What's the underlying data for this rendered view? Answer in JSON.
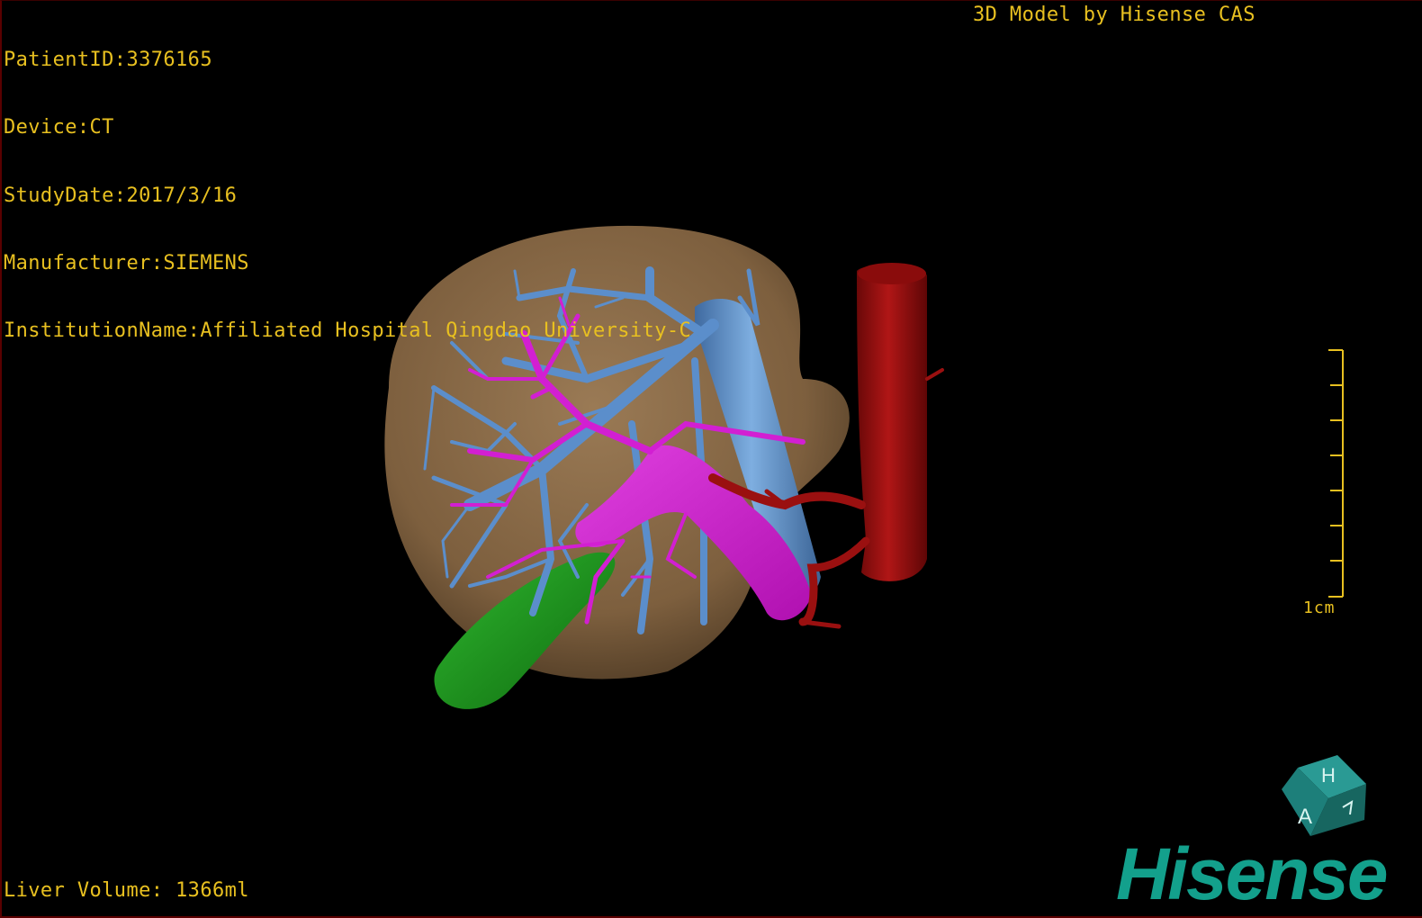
{
  "study": {
    "patient_id": "PatientID:3376165",
    "device": "Device:CT",
    "study_date": "StudyDate:2017/3/16",
    "manufacturer": "Manufacturer:SIEMENS",
    "institution": "InstitutionName:Affiliated Hospital Qingdao University-C"
  },
  "header": {
    "model_credit": "3D Model by Hisense CAS"
  },
  "footer": {
    "liver_volume": "Liver Volume: 1366ml"
  },
  "scale_bar": {
    "label": "1cm",
    "ticks": 8
  },
  "orientation_cube": {
    "face_letters": [
      "H",
      "A"
    ],
    "color": "#1d7f7a"
  },
  "brand": {
    "name": "Hisense",
    "color": "#13a08c"
  },
  "colors": {
    "overlay_text": "#e8c020",
    "liver": "#8a6a45",
    "hepatic_vein": "#5b8ecb",
    "portal_vein": "#d21fd2",
    "artery": "#a01010",
    "gallbladder": "#1f9a1f",
    "background": "#000000"
  },
  "model_icons": [
    "liver-icon",
    "hepatic-vein-icon",
    "portal-vein-icon",
    "aorta-icon",
    "gallbladder-icon"
  ]
}
